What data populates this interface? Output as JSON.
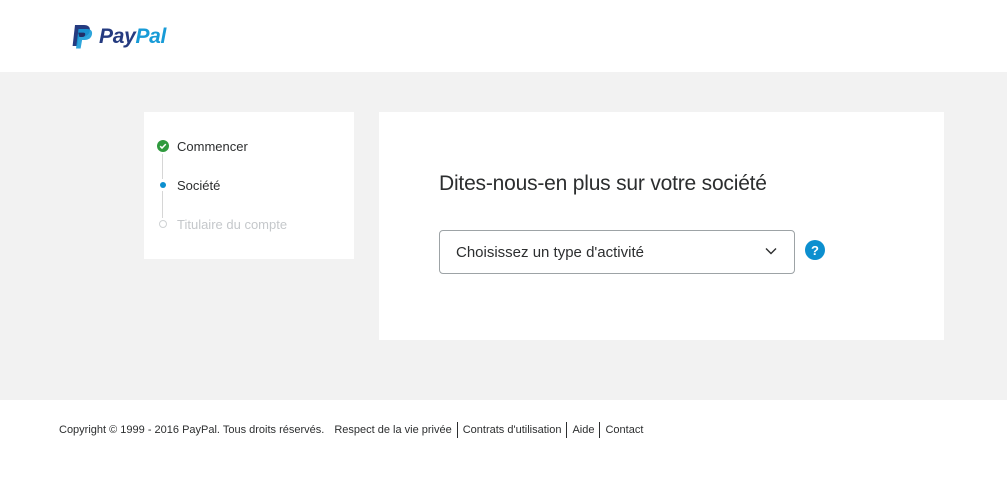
{
  "header": {
    "logo": {
      "pay": "Pay",
      "pal": "Pal",
      "colors": {
        "pay": "#253b80",
        "pal": "#179bd7"
      }
    }
  },
  "stepper": {
    "steps": [
      {
        "label": "Commencer",
        "state": "done",
        "icon": "check-circle-icon"
      },
      {
        "label": "Société",
        "state": "current",
        "icon": "dot-icon"
      },
      {
        "label": "Titulaire du compte",
        "state": "todo",
        "icon": "empty-dot-icon"
      }
    ]
  },
  "card": {
    "title": "Dites-nous-en plus sur votre société",
    "select": {
      "value": "Choisissez un type d'activité",
      "icon": "chevron-down-icon"
    },
    "help": {
      "label": "?",
      "color": "#0c8fcf"
    }
  },
  "footer": {
    "copyright": "Copyright © 1999 - 2016 PayPal. Tous droits réservés.",
    "links": [
      "Respect de la vie privée",
      "Contrats d'utilisation",
      "Aide",
      "Contact"
    ]
  }
}
